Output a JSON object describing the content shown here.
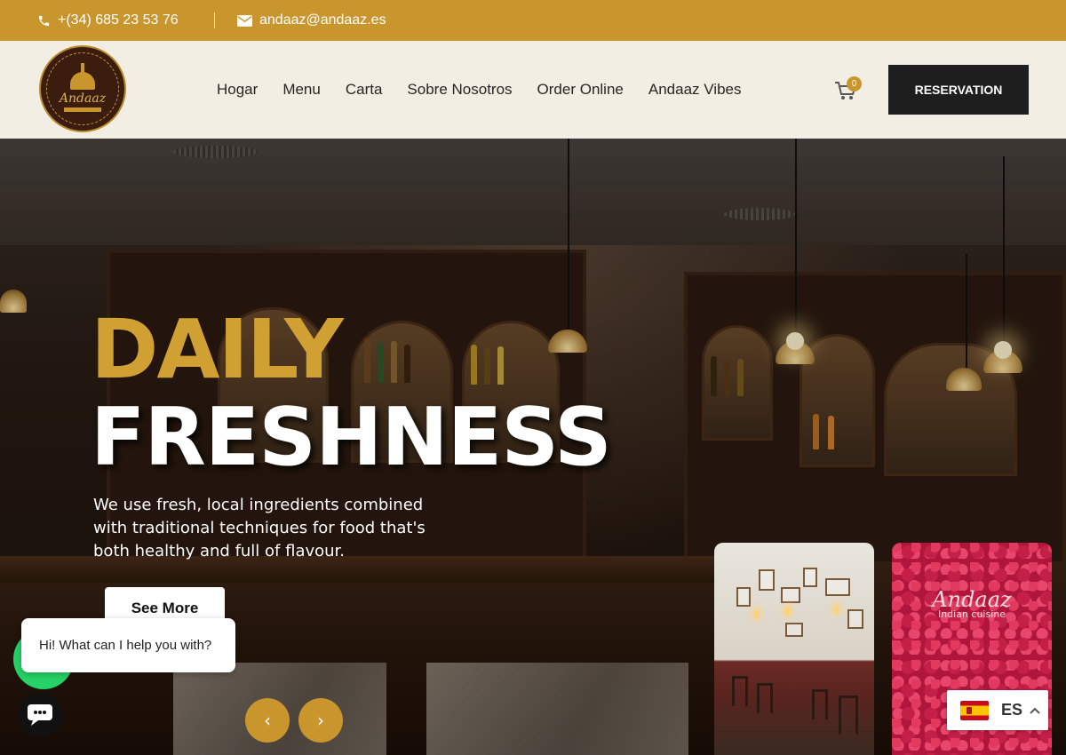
{
  "topbar": {
    "phone": "+(34) 685 23 53 76",
    "email": "andaaz@andaaz.es"
  },
  "header": {
    "logo_text": "Andaaz",
    "nav": [
      {
        "label": "Hogar"
      },
      {
        "label": "Menu"
      },
      {
        "label": "Carta"
      },
      {
        "label": "Sobre Nosotros"
      },
      {
        "label": "Order Online"
      },
      {
        "label": "Andaaz Vibes"
      }
    ],
    "cart_count": "0",
    "reservation_label": "RESERVATION"
  },
  "hero": {
    "title_line1": "DAILY",
    "title_line2": "FRESHNESS",
    "description": "We use fresh, local ingredients combined with traditional techniques for food that's both healthy and full of flavour.",
    "button_label": "See More",
    "prev_arrow": "‹",
    "next_arrow": "›",
    "thumb2_brand": "Andaaz",
    "thumb2_sub": "Indian cuisine"
  },
  "chat": {
    "greeting": "Hi! What can I help you with?"
  },
  "language": {
    "code": "ES"
  },
  "colors": {
    "accent": "#c9962e",
    "header_bg": "#f3eee3",
    "dark": "#1e1e1e",
    "whatsapp": "#25d366"
  }
}
